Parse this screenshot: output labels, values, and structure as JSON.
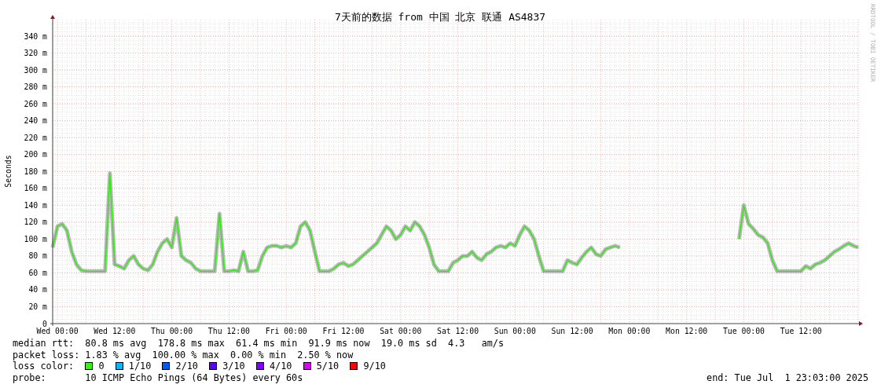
{
  "graph": {
    "credit": "RRDTOOL / TOBI OETIKER",
    "chart_data": {
      "type": "line",
      "title": "7天前的数据 from 中国 北京 联通 AS4837",
      "ylabel": "Seconds",
      "categories": [
        null,
        "Wed 00:00",
        null,
        null,
        null,
        null,
        null,
        null,
        null,
        null,
        null,
        null,
        null,
        "Wed 12:00",
        null,
        null,
        null,
        null,
        null,
        null,
        null,
        null,
        null,
        null,
        null,
        "Thu 00:00",
        null,
        null,
        null,
        null,
        null,
        null,
        null,
        null,
        null,
        null,
        null,
        "Thu 12:00",
        null,
        null,
        null,
        null,
        null,
        null,
        null,
        null,
        null,
        null,
        null,
        "Fri 00:00",
        null,
        null,
        null,
        null,
        null,
        null,
        null,
        null,
        null,
        null,
        null,
        "Fri 12:00",
        null,
        null,
        null,
        null,
        null,
        null,
        null,
        null,
        null,
        null,
        null,
        "Sat 00:00",
        null,
        null,
        null,
        null,
        null,
        null,
        null,
        null,
        null,
        null,
        null,
        "Sat 12:00",
        null,
        null,
        null,
        null,
        null,
        null,
        null,
        null,
        null,
        null,
        null,
        "Sun 00:00",
        null,
        null,
        null,
        null,
        null,
        null,
        null,
        null,
        null,
        null,
        null,
        "Sun 12:00",
        null,
        null,
        null,
        null,
        null,
        null,
        null,
        null,
        null,
        null,
        null,
        "Mon 00:00",
        null,
        null,
        null,
        null,
        null,
        null,
        null,
        null,
        null,
        null,
        null,
        "Mon 12:00",
        null,
        null,
        null,
        null,
        null,
        null,
        null,
        null,
        null,
        null,
        null,
        "Tue 00:00",
        null,
        null,
        null,
        null,
        null,
        null,
        null,
        null,
        null,
        null,
        null,
        "Tue 12:00",
        null,
        null,
        null,
        null,
        null,
        null,
        null,
        null,
        null,
        null,
        null,
        null
      ],
      "series": [
        {
          "color": "#22ee00",
          "values": [
            90,
            115,
            118,
            110,
            85,
            70,
            63,
            62,
            62,
            62,
            62,
            62,
            178,
            70,
            68,
            65,
            75,
            80,
            70,
            65,
            63,
            70,
            85,
            95,
            100,
            90,
            125,
            80,
            75,
            72,
            65,
            62,
            62,
            62,
            62,
            130,
            62,
            62,
            63,
            62,
            85,
            62,
            62,
            63,
            80,
            90,
            92,
            92,
            90,
            92,
            90,
            95,
            115,
            120,
            110,
            85,
            62,
            62,
            62,
            65,
            70,
            72,
            68,
            70,
            75,
            80,
            85,
            90,
            95,
            105,
            115,
            110,
            100,
            105,
            115,
            110,
            120,
            115,
            105,
            90,
            70,
            62,
            62,
            62,
            72,
            75,
            80,
            80,
            85,
            78,
            75,
            82,
            85,
            90,
            92,
            90,
            95,
            92,
            105,
            115,
            110,
            100,
            80,
            62,
            62,
            62,
            62,
            62,
            75,
            72,
            70,
            78,
            85,
            90,
            82,
            80,
            88,
            90,
            92,
            90,
            null,
            null,
            null,
            null,
            null,
            null,
            null,
            null,
            null,
            null,
            null,
            null,
            null,
            null,
            null,
            null,
            null,
            null,
            null,
            null,
            null,
            null,
            null,
            null,
            100,
            140,
            118,
            112,
            105,
            102,
            95,
            75,
            62,
            62,
            62,
            62,
            62,
            62,
            68,
            65,
            70,
            72,
            75,
            80,
            85,
            88,
            92,
            95,
            92,
            90
          ]
        }
      ],
      "ylim": [
        0,
        360
      ],
      "grid": true,
      "yticks": [
        {
          "value": 0,
          "label": "0"
        },
        {
          "value": 20,
          "label": "20 m"
        },
        {
          "value": 40,
          "label": "40 m"
        },
        {
          "value": 60,
          "label": "60 m"
        },
        {
          "value": 80,
          "label": "80 m"
        },
        {
          "value": 100,
          "label": "100 m"
        },
        {
          "value": 120,
          "label": "120 m"
        },
        {
          "value": 140,
          "label": "140 m"
        },
        {
          "value": 160,
          "label": "160 m"
        },
        {
          "value": 180,
          "label": "180 m"
        },
        {
          "value": 200,
          "label": "200 m"
        },
        {
          "value": 220,
          "label": "220 m"
        },
        {
          "value": 240,
          "label": "240 m"
        },
        {
          "value": 260,
          "label": "260 m"
        },
        {
          "value": 280,
          "label": "280 m"
        },
        {
          "value": 300,
          "label": "300 m"
        },
        {
          "value": 320,
          "label": "320 m"
        },
        {
          "value": 340,
          "label": "340 m"
        }
      ]
    }
  },
  "legend": {
    "median_rtt": {
      "label": "median rtt:",
      "items": [
        "80.8 ms avg",
        "178.8 ms max",
        "61.4 ms min",
        "91.9 ms now",
        "19.0 ms sd",
        "4.3   am/s"
      ]
    },
    "packet_loss": {
      "label": "packet loss:",
      "items": [
        "1.83 % avg",
        "100.00 % max",
        "0.00 % min",
        "2.50 % now"
      ]
    },
    "loss_color": {
      "label": "loss color:",
      "items": [
        {
          "label": "0",
          "color": "#26ff00"
        },
        {
          "label": "1/10",
          "color": "#00b8ff"
        },
        {
          "label": "2/10",
          "color": "#0059ff"
        },
        {
          "label": "3/10",
          "color": "#5e00ff"
        },
        {
          "label": "4/10",
          "color": "#7e00ff"
        },
        {
          "label": "5/10",
          "color": "#dd00ff"
        },
        {
          "label": "9/10",
          "color": "#ff0000"
        }
      ]
    },
    "probe": {
      "label": "probe:",
      "value": "10 ICMP Echo Pings (64 Bytes) every 60s"
    },
    "end": "end: Tue Jul  1 23:03:00 2025"
  }
}
